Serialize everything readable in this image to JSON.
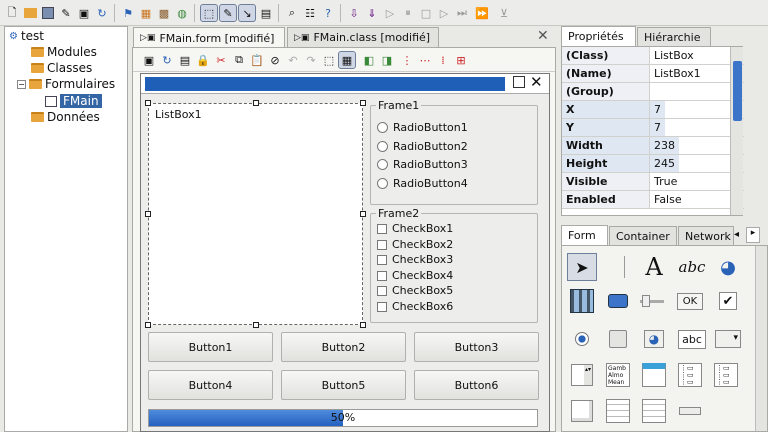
{
  "toolbar": {
    "icons": [
      "new-file-icon",
      "open-folder-icon",
      "save-icon",
      "edit-icon",
      "window-icon",
      "refresh-icon",
      "flag-icon",
      "bag-icon",
      "package-icon",
      "globe-icon",
      "pointer-icon",
      "pen-icon",
      "select-icon",
      "console-icon",
      "find-icon",
      "properties-icon",
      "help-icon",
      "step-into-icon",
      "step-over-icon",
      "run-icon",
      "pause-icon",
      "stop-icon",
      "step-icon",
      "forward-icon",
      "filter-icon"
    ]
  },
  "tree": {
    "root": "test",
    "items": [
      {
        "label": "Modules"
      },
      {
        "label": "Classes"
      },
      {
        "label": "Formulaires"
      },
      {
        "label": "FMain"
      },
      {
        "label": "Données"
      }
    ]
  },
  "tabs": {
    "form": "FMain.form [modifié]",
    "class": "FMain.class [modifié]"
  },
  "form": {
    "listbox_label": "ListBox1",
    "frame1": {
      "title": "Frame1",
      "radios": [
        "RadioButton1",
        "RadioButton2",
        "RadioButton3",
        "RadioButton4"
      ]
    },
    "frame2": {
      "title": "Frame2",
      "checks": [
        "CheckBox1",
        "CheckBox2",
        "CheckBox3",
        "CheckBox4",
        "CheckBox5",
        "CheckBox6"
      ]
    },
    "buttons": [
      "Button1",
      "Button2",
      "Button3",
      "Button4",
      "Button5",
      "Button6"
    ],
    "progress": {
      "value": 50,
      "label": "50%"
    }
  },
  "properties": {
    "tabs": [
      "Propriétés",
      "Hiérarchie"
    ],
    "rows": [
      {
        "name": "(Class)",
        "value": "ListBox"
      },
      {
        "name": "(Name)",
        "value": "ListBox1"
      },
      {
        "name": "(Group)",
        "value": ""
      },
      {
        "name": "X",
        "value": "7"
      },
      {
        "name": "Y",
        "value": "7"
      },
      {
        "name": "Width",
        "value": "238"
      },
      {
        "name": "Height",
        "value": "245"
      },
      {
        "name": "Visible",
        "value": "True"
      },
      {
        "name": "Enabled",
        "value": "False"
      }
    ]
  },
  "toolbox": {
    "tabs": [
      "Form",
      "Container",
      "Network"
    ],
    "label_tool": "A",
    "textlabel_tool": "abc",
    "ok_tool": "OK",
    "textbox_tool": "abc",
    "list_sample": "Gamb Almo Mean",
    "accent": "#2461c0"
  }
}
